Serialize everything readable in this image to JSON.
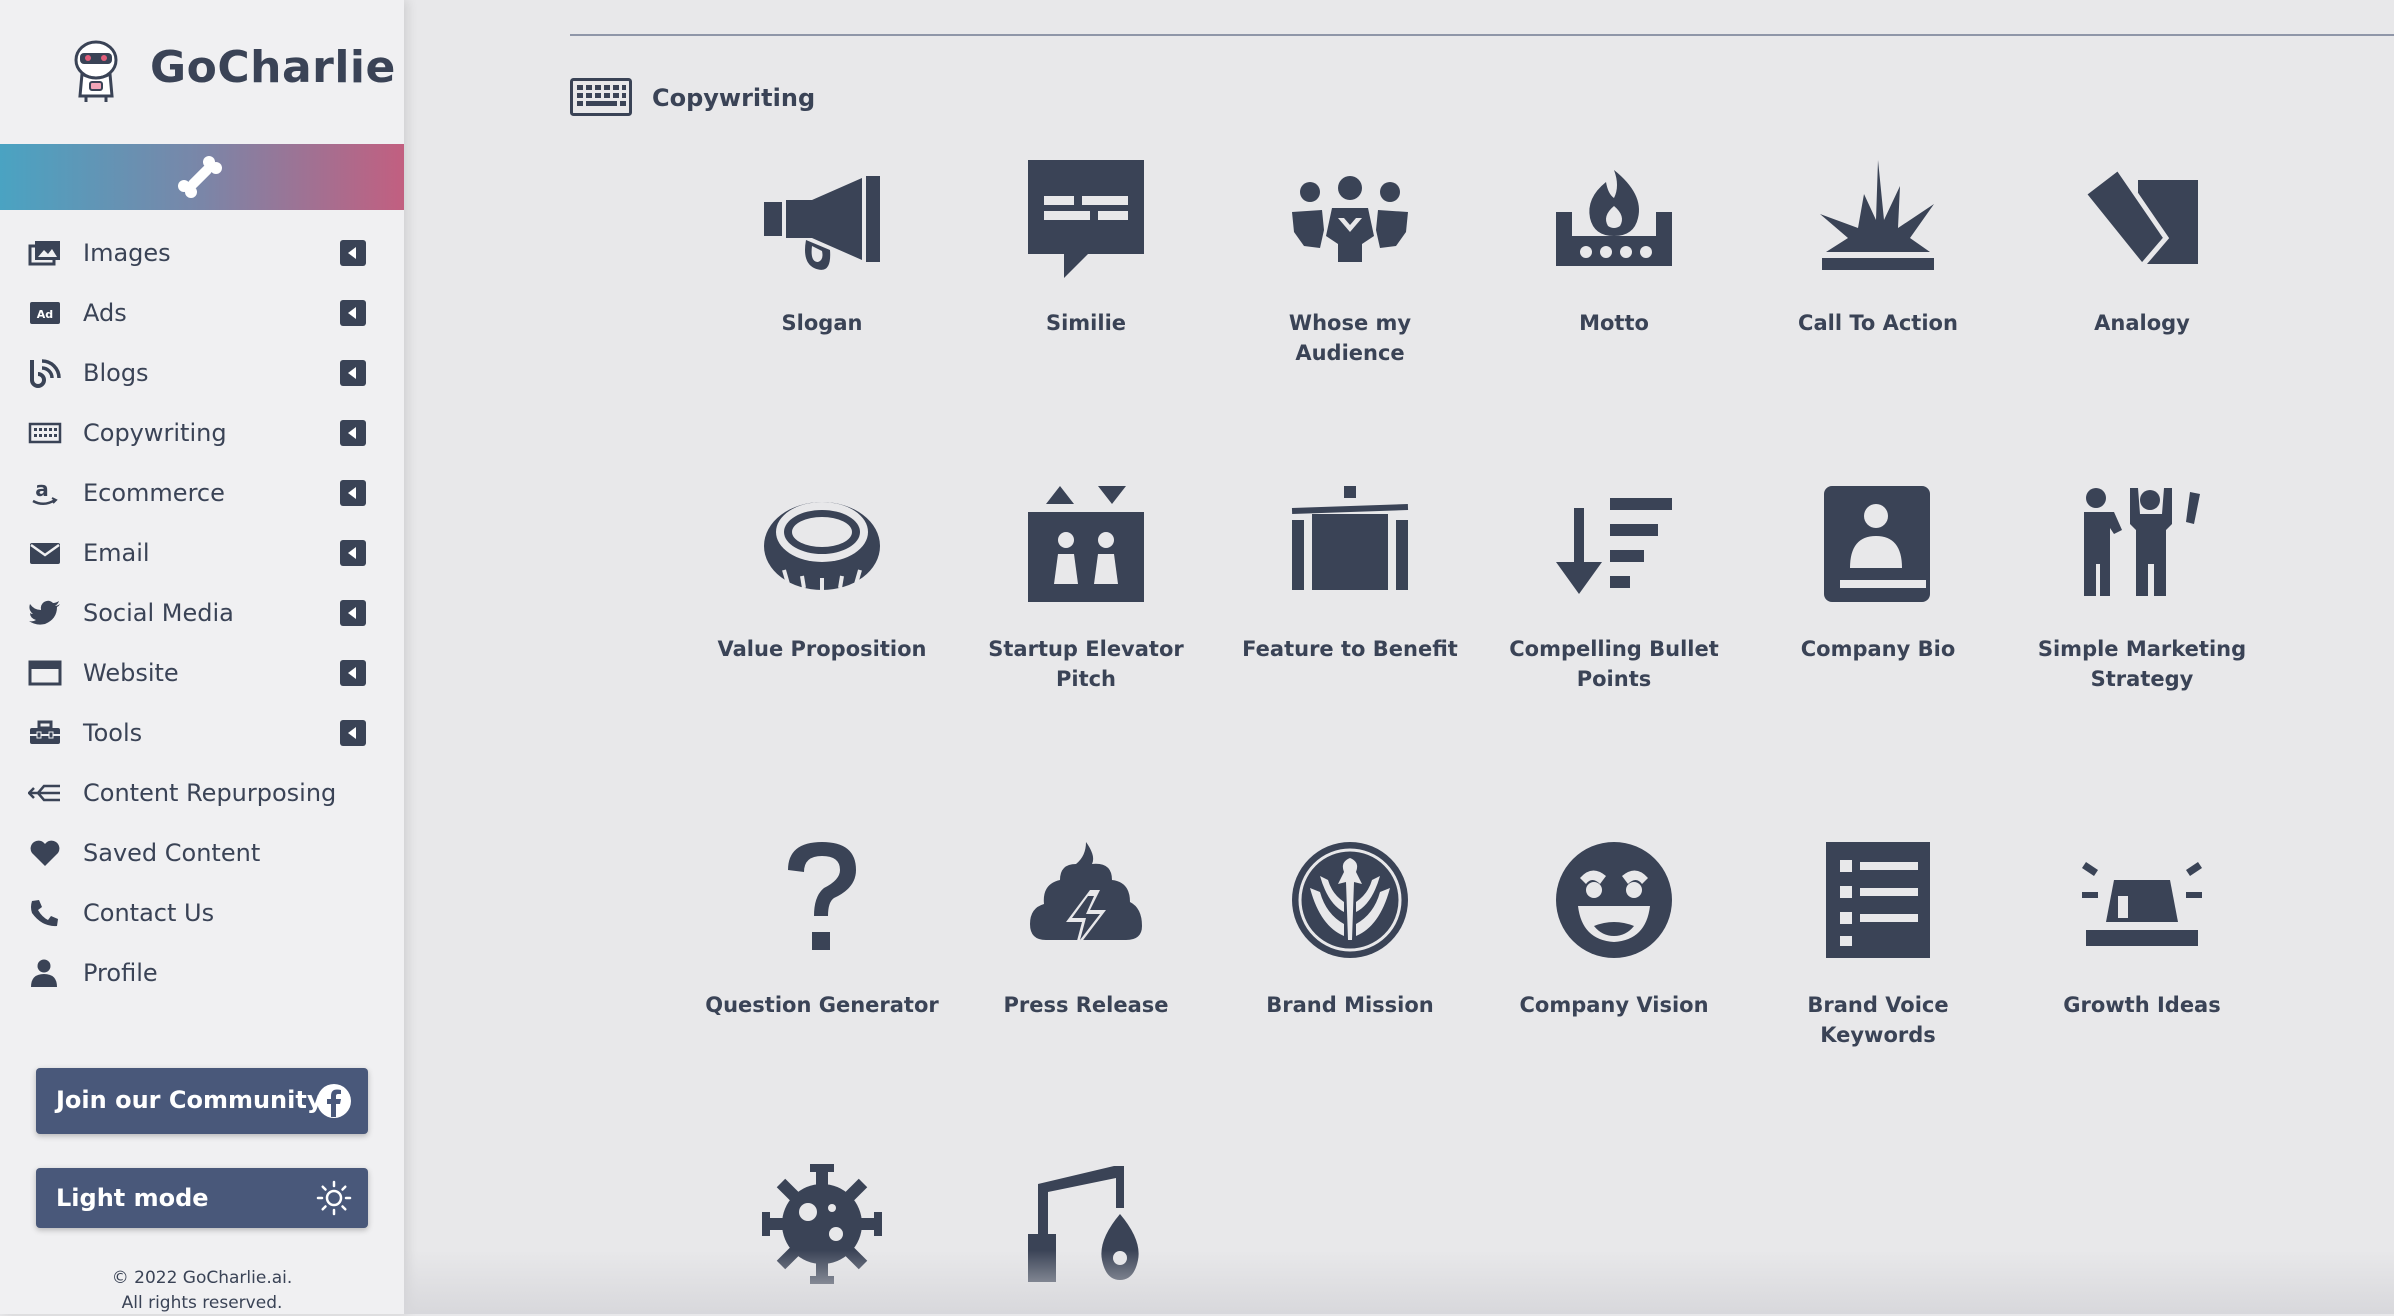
{
  "app": {
    "name": "GoCharlie"
  },
  "sidebar": {
    "items": [
      {
        "label": "Images",
        "icon": "images-icon",
        "has_caret": true
      },
      {
        "label": "Ads",
        "icon": "ad-icon",
        "has_caret": true
      },
      {
        "label": "Blogs",
        "icon": "blog-icon",
        "has_caret": true
      },
      {
        "label": "Copywriting",
        "icon": "keyboard-icon",
        "has_caret": true
      },
      {
        "label": "Ecommerce",
        "icon": "amazon-icon",
        "has_caret": true
      },
      {
        "label": "Email",
        "icon": "envelope-icon",
        "has_caret": true
      },
      {
        "label": "Social Media",
        "icon": "twitter-icon",
        "has_caret": true
      },
      {
        "label": "Website",
        "icon": "window-icon",
        "has_caret": true
      },
      {
        "label": "Tools",
        "icon": "toolbox-icon",
        "has_caret": true
      },
      {
        "label": "Content Repurposing",
        "icon": "merge-arrow-icon",
        "has_caret": false
      },
      {
        "label": "Saved Content",
        "icon": "heart-icon",
        "has_caret": false
      },
      {
        "label": "Contact Us",
        "icon": "phone-icon",
        "has_caret": false
      },
      {
        "label": "Profile",
        "icon": "user-icon",
        "has_caret": false
      }
    ],
    "community_button": "Join our Community!",
    "light_mode_button": "Light mode",
    "footer_line1": "© 2022 GoCharlie.ai.",
    "footer_line2": "All rights reserved."
  },
  "main": {
    "section_title": "Copywriting",
    "tools": [
      {
        "label": "Slogan",
        "icon": "megaphone-icon"
      },
      {
        "label": "Similie",
        "icon": "speech-bubble-icon"
      },
      {
        "label": "Whose my Audience",
        "icon": "people-group-icon"
      },
      {
        "label": "Motto",
        "icon": "campfire-icon"
      },
      {
        "label": "Call To Action",
        "icon": "burst-icon"
      },
      {
        "label": "Analogy",
        "icon": "cards-icon"
      },
      {
        "label": "Value Proposition",
        "icon": "ring-icon"
      },
      {
        "label": "Startup Elevator Pitch",
        "icon": "elevator-icon"
      },
      {
        "label": "Feature to Benefit",
        "icon": "suitcase-icon"
      },
      {
        "label": "Compelling Bullet Points",
        "icon": "sort-list-icon"
      },
      {
        "label": "Company Bio",
        "icon": "contact-book-icon"
      },
      {
        "label": "Simple Marketing Strategy",
        "icon": "presenter-icon"
      },
      {
        "label": "Question Generator",
        "icon": "question-icon"
      },
      {
        "label": "Press Release",
        "icon": "poo-storm-icon"
      },
      {
        "label": "Brand Mission",
        "icon": "phoenix-emblem-icon"
      },
      {
        "label": "Company Vision",
        "icon": "laughing-face-icon"
      },
      {
        "label": "Brand Voice Keywords",
        "icon": "list-icon"
      },
      {
        "label": "Growth Ideas",
        "icon": "siren-icon"
      },
      {
        "label": "",
        "icon": "virus-icon"
      },
      {
        "label": "",
        "icon": "gas-pump-icon"
      }
    ]
  }
}
